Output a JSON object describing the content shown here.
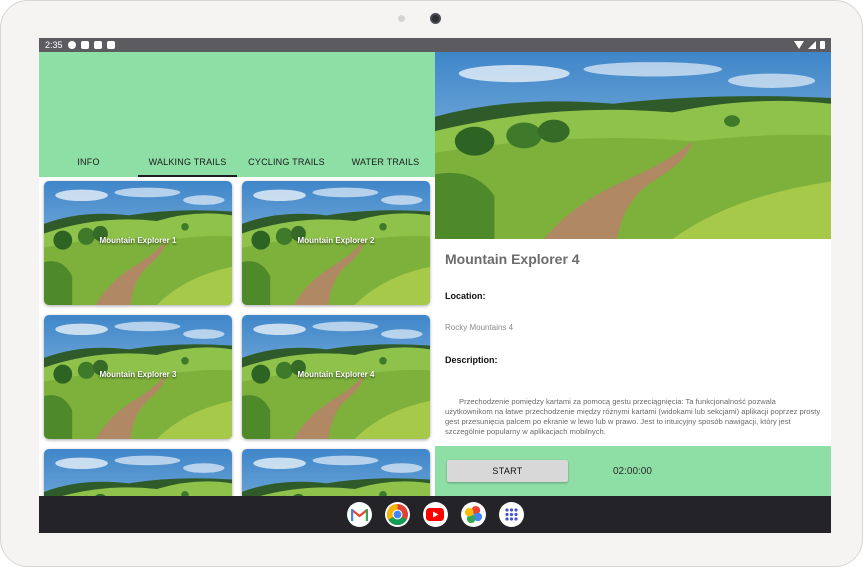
{
  "status_bar": {
    "time": "2:35",
    "icons": [
      "settings-icon",
      "notification-icon",
      "shield-icon",
      "sd-card-icon"
    ],
    "right_icons": [
      "wifi-icon",
      "signal-icon",
      "battery-icon"
    ]
  },
  "tabs": [
    {
      "label": "INFO",
      "active": false
    },
    {
      "label": "WALKING TRAILS",
      "active": true
    },
    {
      "label": "CYCLING TRAILS",
      "active": false
    },
    {
      "label": "WATER TRAILS",
      "active": false
    }
  ],
  "trails": [
    {
      "name": "Mountain Explorer 1"
    },
    {
      "name": "Mountain Explorer 2"
    },
    {
      "name": "Mountain Explorer 3"
    },
    {
      "name": "Mountain Explorer 4"
    },
    {
      "name": ""
    },
    {
      "name": ""
    }
  ],
  "detail": {
    "title": "Mountain Explorer 4",
    "location_label": "Location:",
    "location_value": "Rocky Mountains 4",
    "description_label": "Description:",
    "description_text": "Przechodzenie pomiędzy kartami za pomocą gestu przeciągnięcia: Ta funkcjonalność pozwala użytkownikom na łatwe przechodzenie między różnymi kartami (widokami lub sekcjami) aplikacji poprzez prosty gest przesunięcia palcem po ekranie w lewo lub w prawo. Jest to intuicyjny sposób nawigacji, który jest szczególnie popularny w aplikacjach mobilnych."
  },
  "controls": {
    "start_label": "START",
    "timer": "02:00:00"
  },
  "dock_apps": [
    "gmail-icon",
    "chrome-icon",
    "youtube-icon",
    "photos-icon",
    "app-drawer-icon"
  ],
  "colors": {
    "accent_green": "#8edfa6",
    "status_bar": "#5b5b60",
    "dock": "#232328"
  }
}
